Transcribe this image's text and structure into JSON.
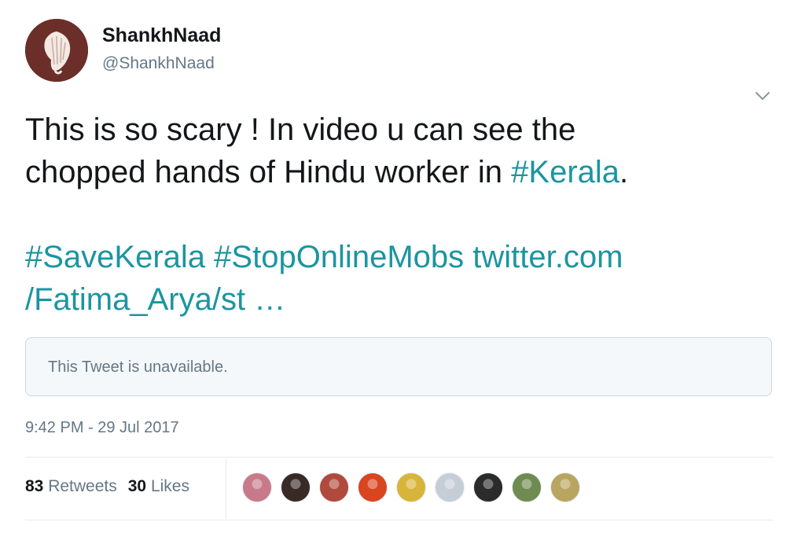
{
  "author": {
    "display_name": "ShankhNaad",
    "handle": "@ShankhNaad",
    "avatar_icon": "conch-shell-icon"
  },
  "menu": {
    "icon": "chevron-down-icon"
  },
  "tweet": {
    "line1": "This is so scary ! In video u can see the",
    "line2_prefix": "chopped hands of Hindu worker in ",
    "line2_hashtag": "#Kerala",
    "line2_suffix": ".",
    "line3": "#SaveKerala #StopOnlineMobs twitter.com",
    "line4": "/Fatima_Arya/st …"
  },
  "quoted_tweet": {
    "text": "This Tweet is unavailable."
  },
  "timestamp": "9:42 PM - 29 Jul 2017",
  "stats": {
    "retweets_count": "83",
    "retweets_label": "Retweets",
    "likes_count": "30",
    "likes_label": "Likes"
  },
  "likers": [
    {
      "name": "liker-avatar-1",
      "color": "#c97a8a"
    },
    {
      "name": "liker-avatar-2",
      "color": "#3a2a26"
    },
    {
      "name": "liker-avatar-3",
      "color": "#b04a3c"
    },
    {
      "name": "liker-avatar-4",
      "color": "#d9451f"
    },
    {
      "name": "liker-avatar-5",
      "color": "#d8b43a"
    },
    {
      "name": "liker-avatar-6",
      "color": "#c5ced6"
    },
    {
      "name": "liker-avatar-7",
      "color": "#2b2b2b"
    },
    {
      "name": "liker-avatar-8",
      "color": "#6f8b4f"
    },
    {
      "name": "liker-avatar-9",
      "color": "#b8a560"
    }
  ],
  "colors": {
    "link": "#1b95a0",
    "secondary_text": "#657786",
    "avatar_bg": "#6b2e28"
  }
}
